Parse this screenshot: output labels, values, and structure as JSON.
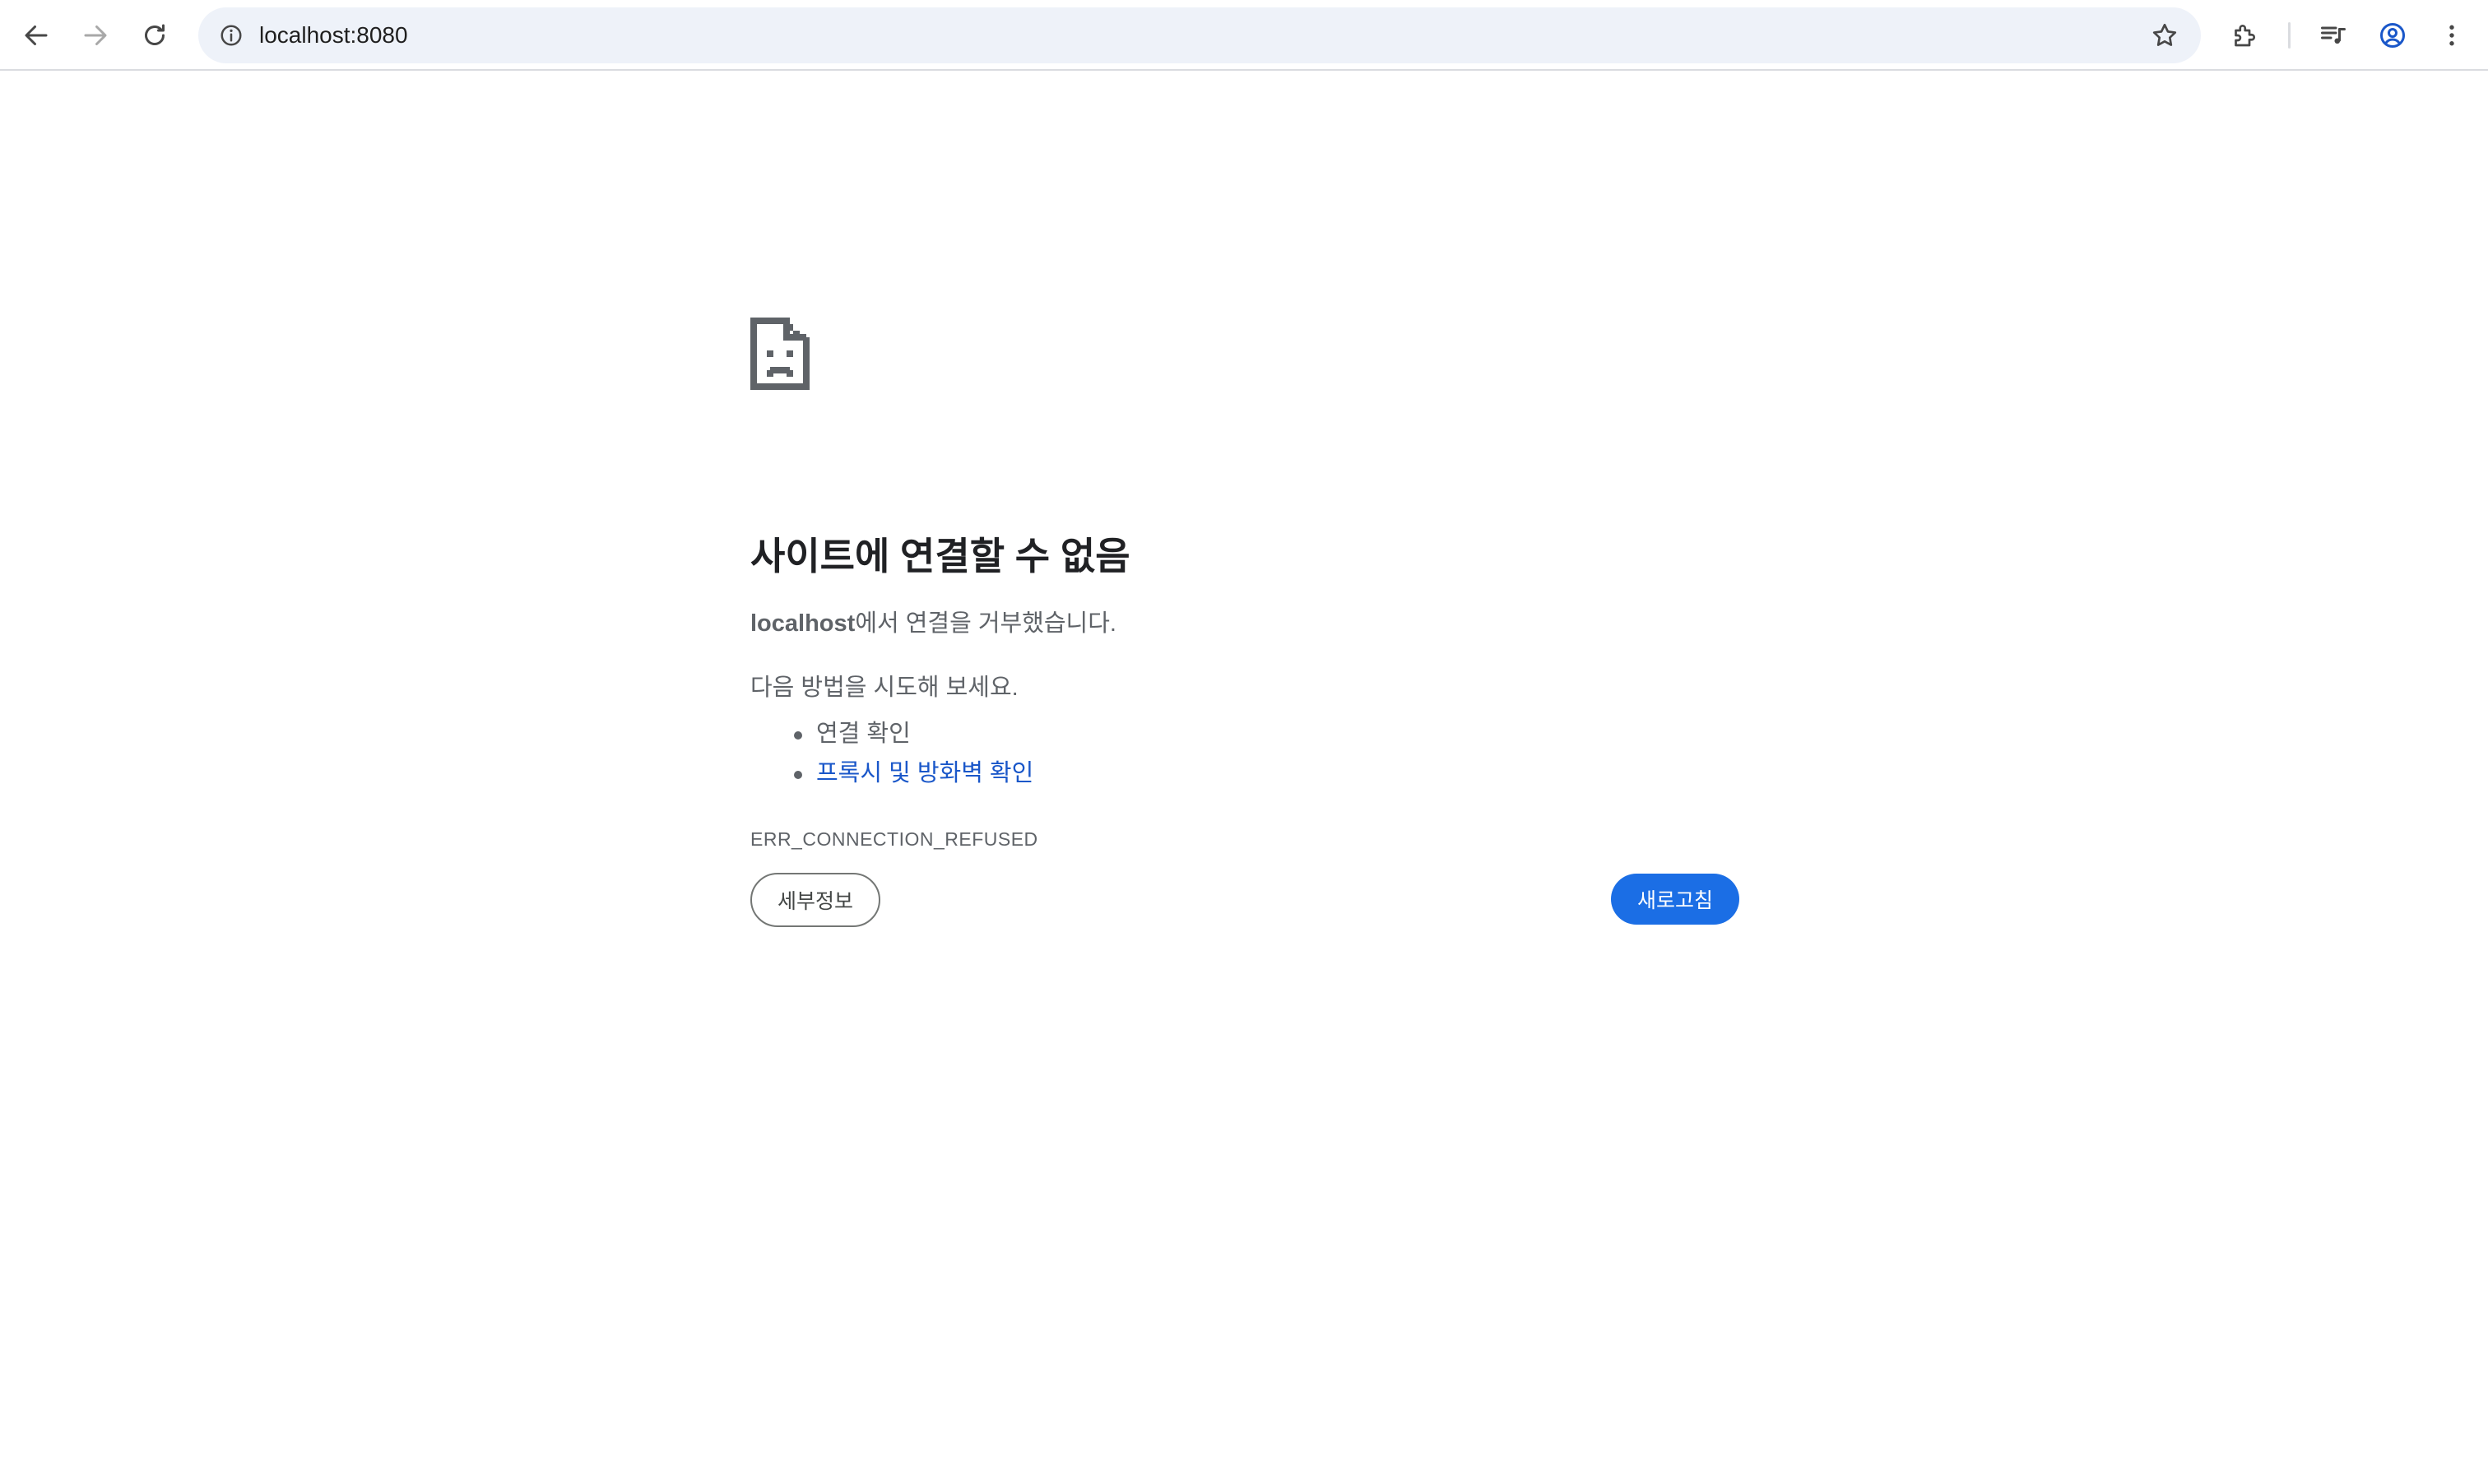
{
  "toolbar": {
    "url": "localhost:8080",
    "icons": {
      "back": "back-arrow-icon",
      "forward": "forward-arrow-icon",
      "reload": "reload-icon",
      "info": "info-icon",
      "bookmark": "star-icon",
      "extensions": "puzzle-icon",
      "media": "media-control-icon",
      "profile": "profile-icon",
      "menu": "more-vert-icon"
    }
  },
  "error": {
    "title": "사이트에 연결할 수 없음",
    "host": "localhost",
    "summary_suffix": "에서 연결을 거부했습니다.",
    "suggestions_heading": "다음 방법을 시도해 보세요.",
    "suggestions": [
      {
        "label": "연결 확인",
        "link": false
      },
      {
        "label": "프록시 및 방화벽 확인",
        "link": true
      }
    ],
    "code": "ERR_CONNECTION_REFUSED",
    "details_label": "세부정보",
    "reload_label": "새로고침"
  },
  "colors": {
    "accent_blue": "#1b6ee5",
    "link_blue": "#1a57c9",
    "text_gray": "#5f6368",
    "omnibox_bg": "#eef2f9"
  }
}
